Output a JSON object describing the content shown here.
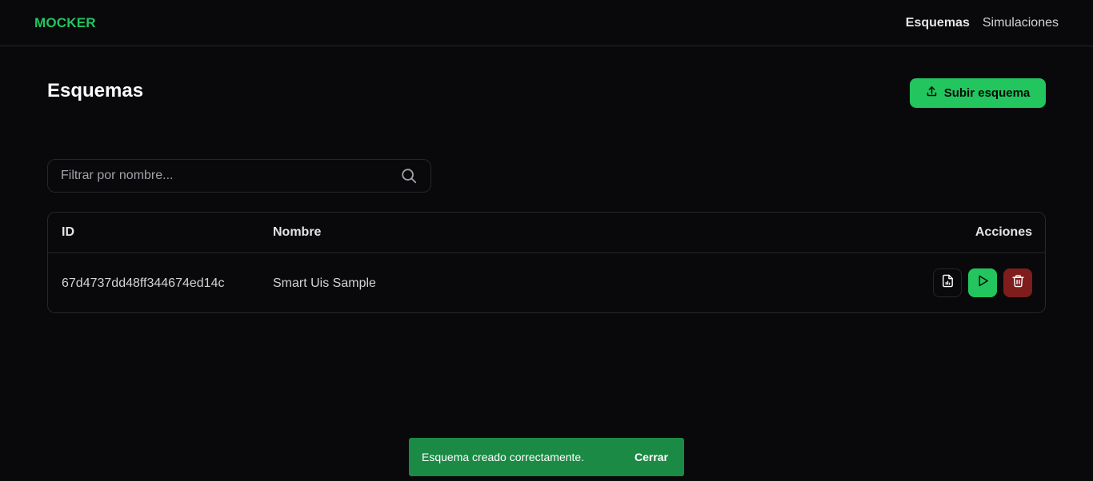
{
  "nav": {
    "brand": "MOCKER",
    "links": [
      {
        "label": "Esquemas",
        "active": true
      },
      {
        "label": "Simulaciones",
        "active": false
      }
    ]
  },
  "page": {
    "title": "Esquemas",
    "upload_label": "Subir esquema"
  },
  "search": {
    "placeholder": "Filtrar por nombre...",
    "value": ""
  },
  "table": {
    "headers": [
      "ID",
      "Nombre",
      "Acciones"
    ],
    "rows": [
      {
        "id": "67d4737dd48ff344674ed14c",
        "name": "Smart Uis Sample"
      }
    ]
  },
  "toast": {
    "message": "Esquema creado correctamente.",
    "close_label": "Cerrar"
  },
  "colors": {
    "accent": "#22c55e",
    "danger": "#7f1d1d",
    "background": "#09090b",
    "toast": "#1b8a44"
  },
  "icons": {
    "upload": "upload-icon",
    "search": "search-icon",
    "schema_doc": "file-chart-icon",
    "run": "play-icon",
    "delete": "trash-icon"
  }
}
